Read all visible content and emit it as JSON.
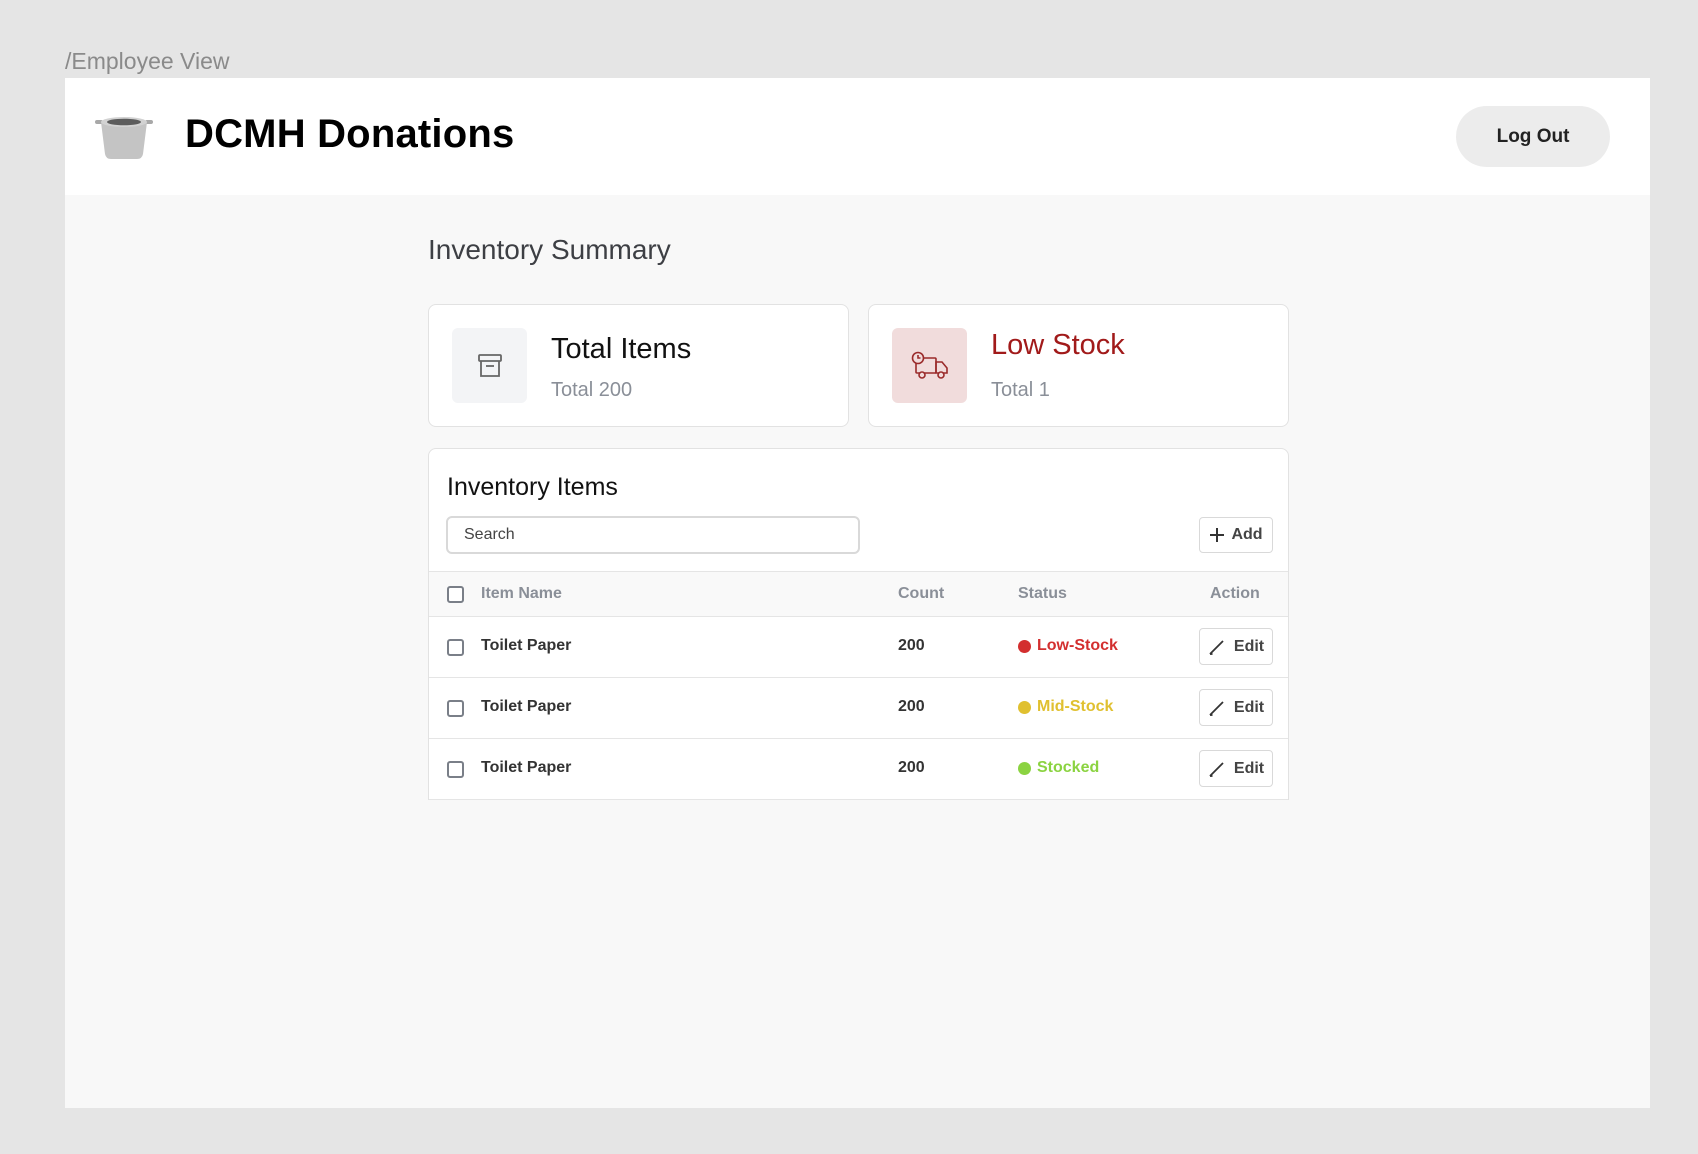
{
  "frame_label": "/Employee View",
  "header": {
    "brand": "DCMH Donations",
    "logo_icon": "cooking-pot-icon",
    "logout_label": "Log Out"
  },
  "summary": {
    "title": "Inventory Summary",
    "total_card": {
      "title": "Total Items",
      "subtitle": "Total 200",
      "icon": "archive-box-icon"
    },
    "low_card": {
      "title": "Low Stock",
      "subtitle": "Total 1",
      "icon": "delivery-truck-icon",
      "accent": "#a11a1a"
    }
  },
  "inventory": {
    "title": "Inventory Items",
    "search_placeholder": "Search",
    "add_label": "Add",
    "columns": {
      "name": "Item Name",
      "count": "Count",
      "status": "Status",
      "action": "Action"
    },
    "rows": [
      {
        "name": "Toilet Paper",
        "count": "200",
        "status": "Low-Stock",
        "status_color": "#d32f2f",
        "action": "Edit"
      },
      {
        "name": "Toilet Paper",
        "count": "200",
        "status": "Mid-Stock",
        "status_color": "#e0c030",
        "action": "Edit"
      },
      {
        "name": "Toilet Paper",
        "count": "200",
        "status": "Stocked",
        "status_color": "#8bd341",
        "action": "Edit"
      }
    ]
  }
}
